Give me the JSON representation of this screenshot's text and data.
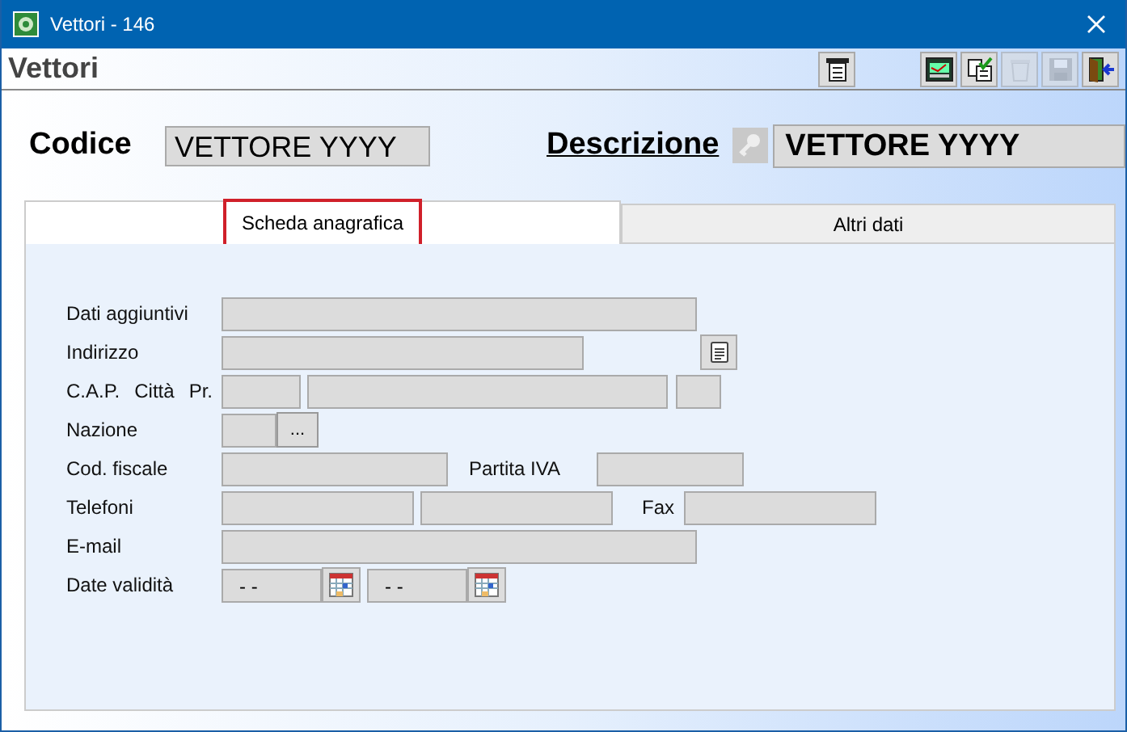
{
  "window": {
    "title": "Vettori - 146"
  },
  "header": {
    "title": "Vettori",
    "toolbar": [
      {
        "kind": "list",
        "disabled": false
      },
      {
        "kind": "screen",
        "disabled": false
      },
      {
        "kind": "check",
        "disabled": false
      },
      {
        "kind": "trash",
        "disabled": true
      },
      {
        "kind": "save",
        "disabled": true
      },
      {
        "kind": "exit",
        "disabled": false
      }
    ]
  },
  "record": {
    "code_label": "Codice",
    "code": "VETTORE YYYY",
    "description_label": "Descrizione",
    "description": "VETTORE YYYY"
  },
  "tabs": [
    {
      "label": "Scheda anagrafica",
      "selected": true
    },
    {
      "label": "Altri dati",
      "selected": false
    }
  ],
  "form": {
    "dati_aggiuntivi": "Dati aggiuntivi",
    "indirizzo": "Indirizzo",
    "cap": "C.A.P.",
    "citta": "Città",
    "pr": "Pr.",
    "nazione": "Nazione",
    "nazione_button": "...",
    "cod_fiscale": "Cod. fiscale",
    "partita_iva": "Partita IVA",
    "telefoni": "Telefoni",
    "fax": "Fax",
    "email": "E-mail",
    "date_validita": "Date validità",
    "date_from": "- -",
    "date_to": "- -"
  }
}
